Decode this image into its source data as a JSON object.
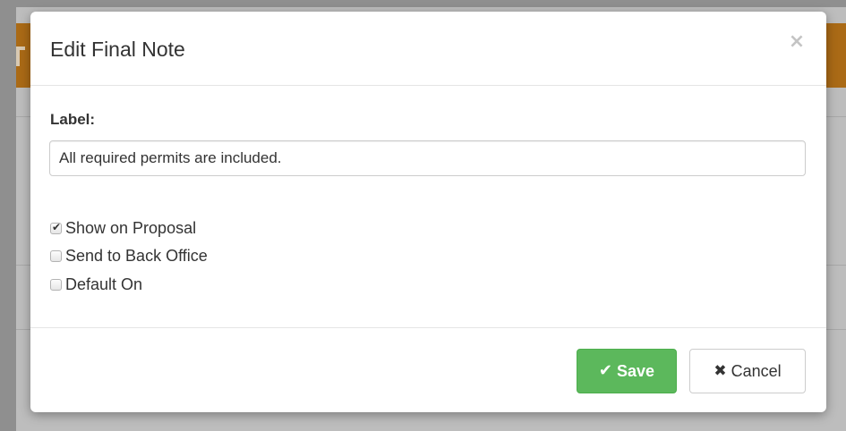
{
  "dialog": {
    "title": "Edit Final Note",
    "close_glyph": "×"
  },
  "form": {
    "label_text": "Label:",
    "label_value": "All required permits are included.",
    "options": [
      {
        "label": "Show on Proposal",
        "checked": true
      },
      {
        "label": "Send to Back Office",
        "checked": false
      },
      {
        "label": "Default On",
        "checked": false
      }
    ]
  },
  "footer": {
    "save_label": "Save",
    "save_icon": "check-icon",
    "save_glyph": "✔",
    "cancel_label": "Cancel",
    "cancel_icon": "times-icon",
    "cancel_glyph": "✖"
  },
  "colors": {
    "save_button": "#5cb85c",
    "header_bar": "#aa6a16"
  }
}
